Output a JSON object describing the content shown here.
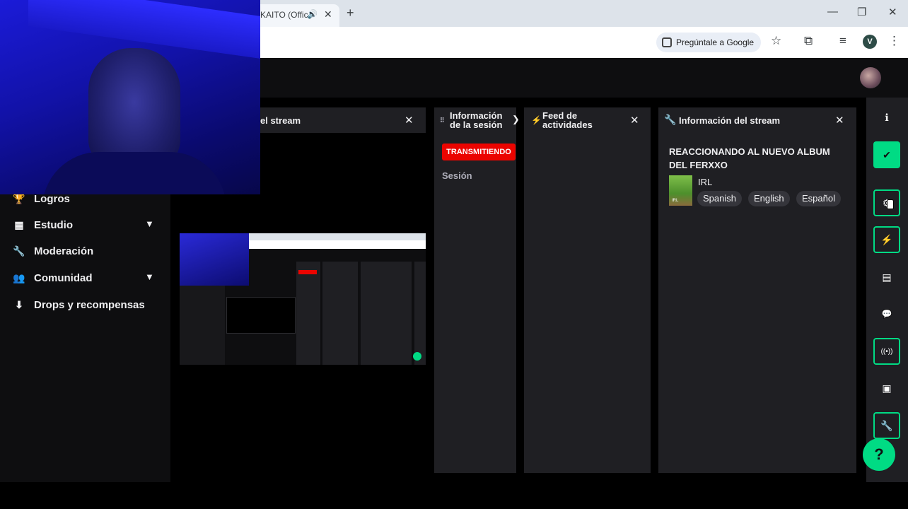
{
  "browser": {
    "tab_title": "KAITO (Offic",
    "audio_icon": "speaker-icon",
    "tab_close": "✕",
    "new_tab": "+",
    "window_controls": [
      "—",
      "❐",
      "✕"
    ],
    "ask_google": "Pregúntale a Google",
    "profile_initial": "V"
  },
  "sidebar": {
    "items": [
      {
        "label": "Logros",
        "icon": "trophy-icon",
        "expandable": false
      },
      {
        "label": "Estudio",
        "icon": "studio-icon",
        "expandable": true
      },
      {
        "label": "Moderación",
        "icon": "wrench-icon",
        "expandable": false
      },
      {
        "label": "Comunidad",
        "icon": "community-icon",
        "expandable": true
      },
      {
        "label": "Drops y recompensas",
        "icon": "drops-icon",
        "expandable": false
      }
    ]
  },
  "panels": {
    "stream_preview": {
      "title": "el stream",
      "close": "✕"
    },
    "session": {
      "title": "Información de la sesión",
      "live_badge": "TRANSMITIENDO",
      "session_label": "Sesión"
    },
    "activity": {
      "title": "Feed de actividades",
      "close": "✕"
    },
    "stream_info": {
      "title": "Información del stream",
      "close": "✕",
      "stream_title": "REACCIONANDO AL NUEVO ALBUM DEL FERXXO",
      "category": "IRL",
      "thumb_label": "IRL",
      "tags": [
        "Spanish",
        "English",
        "Español"
      ]
    }
  },
  "rail": {
    "buttons": [
      {
        "icon": "info-icon",
        "glyph": "ℹ",
        "style": "plain"
      },
      {
        "icon": "check-icon",
        "glyph": "✔",
        "style": "filled"
      },
      {
        "icon": "stream-settings-icon",
        "glyph": "⚙",
        "style": "outline"
      },
      {
        "icon": "bolt-icon",
        "glyph": "⚡",
        "style": "outline"
      },
      {
        "icon": "document-icon",
        "glyph": "▤",
        "style": "plain"
      },
      {
        "icon": "chat-icon",
        "glyph": "💬",
        "style": "plain"
      },
      {
        "icon": "broadcast-icon",
        "glyph": "((•))",
        "style": "outline"
      },
      {
        "icon": "camera-icon",
        "glyph": "▣",
        "style": "plain"
      },
      {
        "icon": "wrench-icon",
        "glyph": "🔧",
        "style": "outline"
      }
    ],
    "help_glyph": "?"
  },
  "colors": {
    "accent_green": "#00db84",
    "live_red": "#eb0400",
    "panel_bg": "#1f1f23",
    "app_bg": "#0e0e10"
  }
}
